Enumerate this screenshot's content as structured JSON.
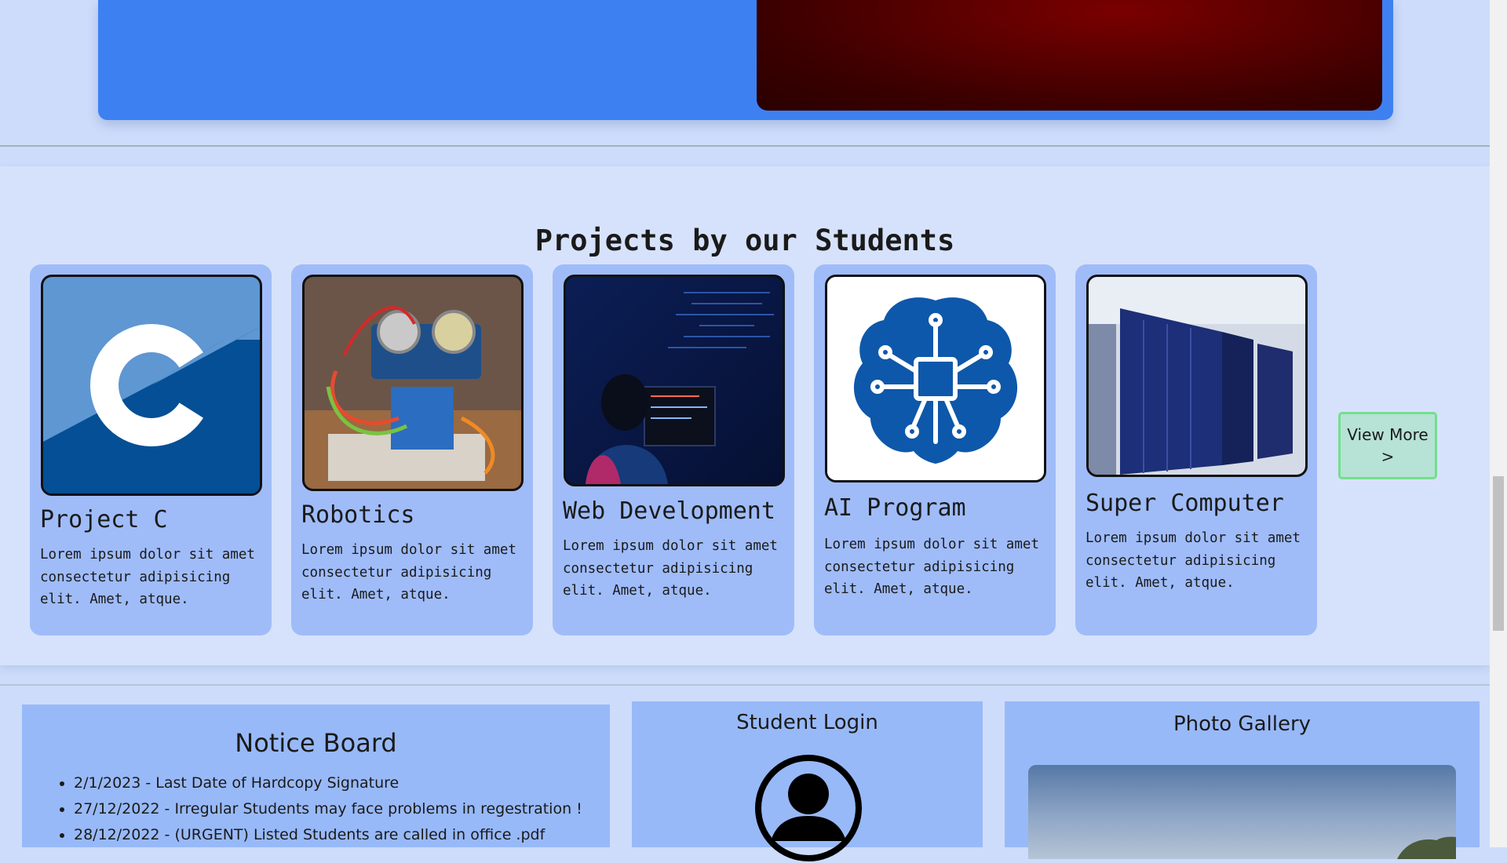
{
  "projects": {
    "title": "Projects by our Students",
    "cards": [
      {
        "title": "Project C",
        "desc": "Lorem ipsum dolor sit amet consectetur adipisicing elit. Amet, atque."
      },
      {
        "title": "Robotics",
        "desc": "Lorem ipsum dolor sit amet consectetur adipisicing elit. Amet, atque."
      },
      {
        "title": "Web Development",
        "desc": "Lorem ipsum dolor sit amet consectetur adipisicing elit. Amet, atque."
      },
      {
        "title": "AI Program",
        "desc": "Lorem ipsum dolor sit amet consectetur adipisicing elit. Amet, atque."
      },
      {
        "title": "Super Computer",
        "desc": "Lorem ipsum dolor sit amet consectetur adipisicing elit. Amet, atque."
      }
    ],
    "view_more": "View More >"
  },
  "notice_board": {
    "title": "Notice Board",
    "items": [
      "2/1/2023 - Last Date of Hardcopy Signature",
      "27/12/2022 - Irregular Students may face problems in regestration !",
      "28/12/2022 - (URGENT) Listed Students are called in office .pdf"
    ]
  },
  "student_login": {
    "title": "Student Login",
    "icon": "user-avatar-icon"
  },
  "photo_gallery": {
    "title": "Photo Gallery"
  },
  "colors": {
    "page_bg": "#cddcfb",
    "hero_blue": "#3d80f2",
    "card_bg": "#9fbcf9",
    "panel_bg": "#98b9f8",
    "view_more_bg": "#b7e2d6",
    "view_more_border": "#72df8c"
  }
}
